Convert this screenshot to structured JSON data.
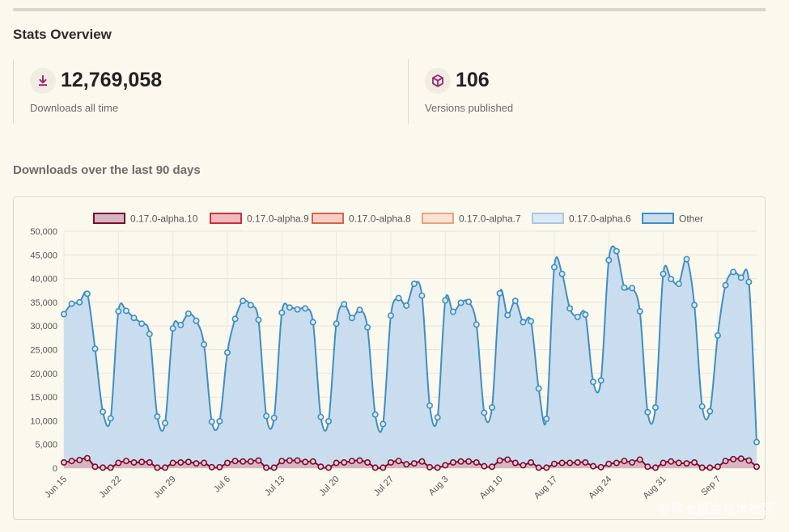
{
  "stats": {
    "title": "Stats Overview",
    "downloads_value": "12,769,058",
    "downloads_label": "Downloads all time",
    "versions_value": "106",
    "versions_label": "Versions published",
    "icon_color": "#9b2a6b"
  },
  "chart_section": {
    "title": "Downloads over the last 90 days"
  },
  "watermark": "@稀土掘金技术社区",
  "chart_data": {
    "type": "area",
    "stacked": true,
    "ylim": [
      0,
      50000
    ],
    "y_ticks": [
      0,
      5000,
      10000,
      15000,
      20000,
      25000,
      30000,
      35000,
      40000,
      45000,
      50000
    ],
    "y_tick_labels": [
      "0",
      "5,000",
      "10,000",
      "15,000",
      "20,000",
      "25,000",
      "30,000",
      "35,000",
      "40,000",
      "45,000",
      "50,000"
    ],
    "x_tick_labels": [
      "Jun 15",
      "Jun 22",
      "Jun 29",
      "Jul 6",
      "Jul 13",
      "Jul 20",
      "Jul 27",
      "Aug 3",
      "Aug 10",
      "Aug 17",
      "Aug 24",
      "Aug 31",
      "Sep 7"
    ],
    "x_tick_indices": [
      0,
      7,
      14,
      21,
      28,
      35,
      42,
      49,
      56,
      63,
      70,
      77,
      84
    ],
    "grid": true,
    "legend_position": "top",
    "series": [
      {
        "name": "0.17.0-alpha.10",
        "stroke": "#7a0f2e",
        "fill": "#d8b5c2",
        "values": [
          1200,
          1500,
          1700,
          2100,
          300,
          100,
          100,
          1100,
          1500,
          1200,
          1300,
          1200,
          100,
          100,
          1100,
          1200,
          1300,
          1000,
          1100,
          200,
          200,
          1100,
          1500,
          1400,
          1400,
          1600,
          100,
          100,
          1500,
          1600,
          1600,
          1300,
          1400,
          300,
          100,
          1100,
          1200,
          1500,
          1600,
          1200,
          100,
          100,
          1200,
          1500,
          800,
          1000,
          1400,
          200,
          100,
          600,
          1200,
          1400,
          1400,
          1200,
          400,
          300,
          1600,
          1800,
          1100,
          600,
          1200,
          100,
          100,
          900,
          1100,
          1100,
          1200,
          1200,
          400,
          200,
          900,
          1100,
          1500,
          1200,
          1800,
          300,
          100,
          1100,
          1400,
          1100,
          1000,
          1200,
          100,
          100,
          300,
          1500,
          1900,
          2000,
          1600,
          300
        ]
      },
      {
        "name": "0.17.0-alpha.9",
        "stroke": "#c0343f",
        "fill": "#f4b9bd"
      },
      {
        "name": "0.17.0-alpha.8",
        "stroke": "#d2664a",
        "fill": "#f8cfc4"
      },
      {
        "name": "0.17.0-alpha.7",
        "stroke": "#e7a37d",
        "fill": "#fbe3d4"
      },
      {
        "name": "0.17.0-alpha.6",
        "stroke": "#a9c8df",
        "fill": "#dbe9f4"
      },
      {
        "name": "Other",
        "stroke": "#3f8fc1",
        "fill": "#c9ddef",
        "values": [
          31300,
          33200,
          33300,
          34700,
          24900,
          11800,
          10400,
          32000,
          31700,
          30500,
          29200,
          27100,
          10800,
          9400,
          28400,
          29000,
          31300,
          30100,
          25000,
          9600,
          9700,
          23300,
          30000,
          33900,
          33000,
          29700,
          10900,
          10500,
          31300,
          32300,
          31900,
          32400,
          29400,
          10500,
          9800,
          29400,
          33400,
          30200,
          31800,
          28500,
          11200,
          9200,
          31000,
          34400,
          33500,
          37900,
          35000,
          13000,
          10600,
          34800,
          31800,
          33500,
          33700,
          29100,
          11300,
          12500,
          35300,
          30500,
          34200,
          30200,
          29800,
          16700,
          10300,
          41500,
          39900,
          32600,
          30700,
          31200,
          17800,
          18300,
          43000,
          44700,
          36600,
          36800,
          31300,
          11500,
          12700,
          39900,
          38500,
          37800,
          43100,
          33200,
          12900,
          11900,
          27700,
          37100,
          39500,
          38200,
          37700,
          5200
        ]
      }
    ]
  }
}
